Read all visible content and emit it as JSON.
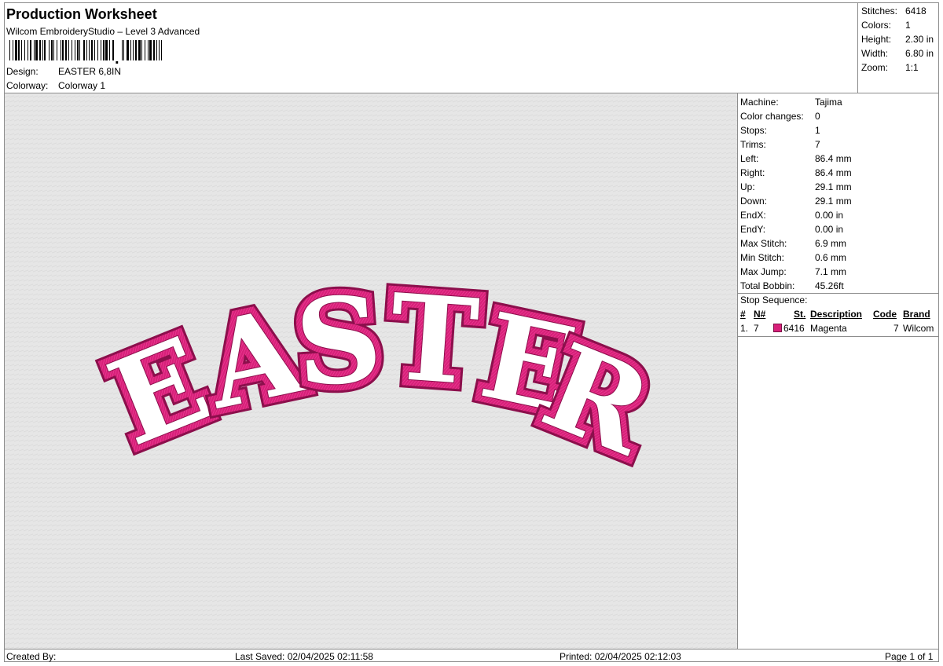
{
  "header": {
    "title": "Production Worksheet",
    "subtitle": "Wilcom EmbroideryStudio – Level 3 Advanced",
    "design_label": "Design:",
    "design_value": "EASTER 6,8IN",
    "colorway_label": "Colorway:",
    "colorway_value": "Colorway 1"
  },
  "summary": {
    "stitches_label": "Stitches:",
    "stitches": "6418",
    "colors_label": "Colors:",
    "colors": "1",
    "height_label": "Height:",
    "height": "2.30 in",
    "width_label": "Width:",
    "width": "6.80 in",
    "zoom_label": "Zoom:",
    "zoom": "1:1"
  },
  "design_preview": {
    "text": "EASTER",
    "thread_color": "#d8207a",
    "outline_color": "#8c0f4c",
    "background": "#e6e6e6"
  },
  "machine_info": [
    {
      "label": "Machine:",
      "value": "Tajima"
    },
    {
      "label": "Color changes:",
      "value": "0"
    },
    {
      "label": "Stops:",
      "value": "1"
    },
    {
      "label": "Trims:",
      "value": "7"
    },
    {
      "label": "Left:",
      "value": "86.4 mm"
    },
    {
      "label": "Right:",
      "value": "86.4 mm"
    },
    {
      "label": "Up:",
      "value": "29.1 mm"
    },
    {
      "label": "Down:",
      "value": "29.1 mm"
    },
    {
      "label": "EndX:",
      "value": "0.00 in"
    },
    {
      "label": "EndY:",
      "value": "0.00 in"
    },
    {
      "label": "Max Stitch:",
      "value": "6.9 mm"
    },
    {
      "label": "Min Stitch:",
      "value": "0.6 mm"
    },
    {
      "label": "Max Jump:",
      "value": "7.1 mm"
    },
    {
      "label": "Total Bobbin:",
      "value": "45.26ft"
    }
  ],
  "stop_sequence": {
    "title": "Stop Sequence:",
    "columns": [
      "#",
      "N#",
      "St.",
      "Description",
      "Code",
      "Brand"
    ],
    "rows": [
      {
        "index": "1.",
        "needle": "7",
        "color": "#d8207a",
        "stitches": "6416",
        "description": "Magenta",
        "code": "7",
        "brand": "Wilcom"
      }
    ]
  },
  "footer": {
    "created_by": "Created By:",
    "last_saved": "Last Saved: 02/04/2025 02:11:58",
    "printed": "Printed: 02/04/2025 02:12:03",
    "page": "Page 1 of 1"
  }
}
